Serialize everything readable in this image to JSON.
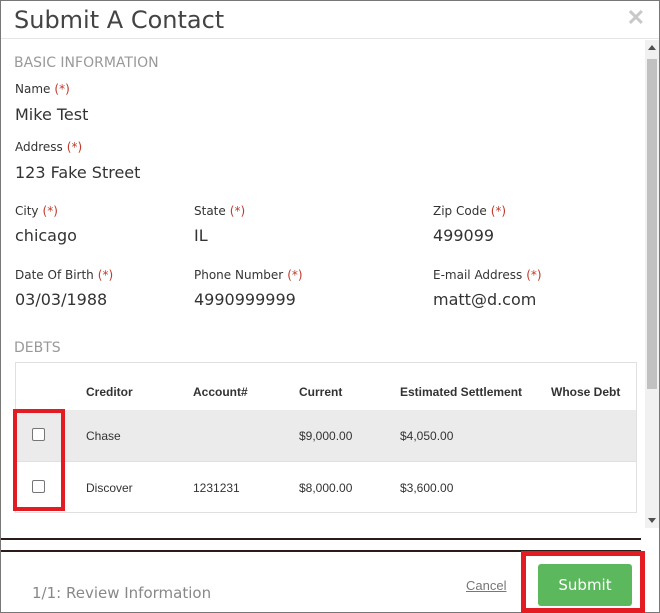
{
  "modal": {
    "title": "Submit A Contact",
    "close_symbol": "✕"
  },
  "basic": {
    "section_title": "BASIC INFORMATION",
    "name": {
      "label": "Name",
      "req": "(*)",
      "value": "Mike Test"
    },
    "address": {
      "label": "Address",
      "req": "(*)",
      "value": "123 Fake Street"
    },
    "city": {
      "label": "City",
      "req": "(*)",
      "value": "chicago"
    },
    "state": {
      "label": "State",
      "req": "(*)",
      "value": "IL"
    },
    "zip": {
      "label": "Zip Code",
      "req": "(*)",
      "value": "499099"
    },
    "dob": {
      "label": "Date Of Birth",
      "req": "(*)",
      "value": "03/03/1988"
    },
    "phone": {
      "label": "Phone Number",
      "req": "(*)",
      "value": "4990999999"
    },
    "email": {
      "label": "E-mail Address",
      "req": "(*)",
      "value": "matt@d.com"
    }
  },
  "debts": {
    "section_title": "DEBTS",
    "columns": [
      "Creditor",
      "Account#",
      "Current",
      "Estimated Settlement",
      "Whose Debt"
    ],
    "rows": [
      {
        "creditor": "Chase",
        "account": "",
        "current": "$9,000.00",
        "settlement": "$4,050.00",
        "whose": ""
      },
      {
        "creditor": "Discover",
        "account": "1231231",
        "current": "$8,000.00",
        "settlement": "$3,600.00",
        "whose": ""
      }
    ]
  },
  "footer": {
    "step": "1/1: Review Information",
    "cancel_label": "Cancel",
    "submit_label": "Submit"
  },
  "colors": {
    "submit": "#5cb85c",
    "highlight": "#e31b23",
    "required": "#c0392b"
  }
}
